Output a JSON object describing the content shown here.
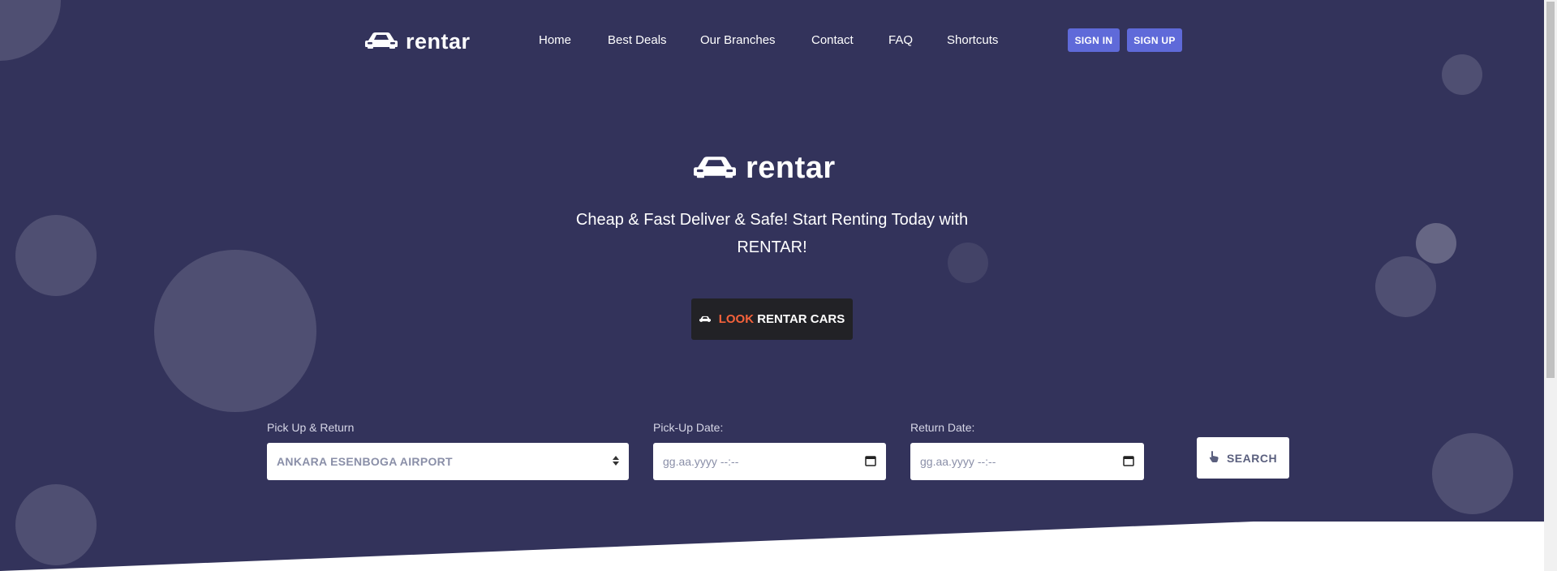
{
  "brand": {
    "name": "rentar"
  },
  "nav": {
    "items": [
      {
        "label": "Home"
      },
      {
        "label": "Best Deals"
      },
      {
        "label": "Our Branches"
      },
      {
        "label": "Contact"
      },
      {
        "label": "FAQ"
      },
      {
        "label": "Shortcuts"
      }
    ],
    "sign_in": "SIGN IN",
    "sign_up": "SIGN UP"
  },
  "hero": {
    "tagline_line1": "Cheap & Fast Deliver & Safe! Start Renting Today with",
    "tagline_brand": "RENTAR",
    "tagline_end": "!",
    "cta_accent": "LOOK",
    "cta_rest": "RENTAR CARS"
  },
  "search": {
    "pickup_return_label": "Pick Up & Return",
    "pickup_return_value": "ANKARA ESENBOGA AIRPORT",
    "pickup_date_label": "Pick-Up Date:",
    "pickup_date_placeholder": "gg.aa.yyyy --:--",
    "return_date_label": "Return Date:",
    "return_date_placeholder": "gg.aa.yyyy --:--",
    "search_label": "SEARCH"
  },
  "colors": {
    "hero_bg": "#33335b",
    "auth_button": "#5f6ad9",
    "cta_bg": "#222226",
    "cta_accent": "#f5623b"
  },
  "icons": {
    "logo": "car-icon",
    "cta": "car-icon",
    "search": "pointer-hand-icon",
    "select": "sort-arrows-icon",
    "date": "calendar-icon"
  }
}
